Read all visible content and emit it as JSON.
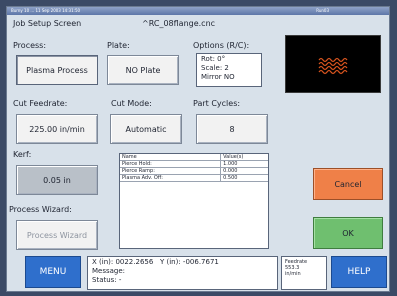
{
  "window": {
    "title_left": "Burny 10 ... 11 Sep 2003 14:31:50",
    "title_right": "Run03"
  },
  "screen": {
    "title": "Job Setup Screen",
    "filename": "^RC_08flange.cnc"
  },
  "process": {
    "label": "Process:",
    "value": "Plasma Process"
  },
  "plate": {
    "label": "Plate:",
    "value": "NO Plate"
  },
  "options": {
    "label": "Options (R/C):",
    "rot": "Rot: 0°",
    "scale": "Scale: 2",
    "mirror": "Mirror NO"
  },
  "cut_feedrate": {
    "label": "Cut Feedrate:",
    "value": "225.00 in/min"
  },
  "cut_mode": {
    "label": "Cut Mode:",
    "value": "Automatic"
  },
  "part_cycles": {
    "label": "Part Cycles:",
    "value": "8"
  },
  "kerf": {
    "label": "Kerf:",
    "value": "0.05 in"
  },
  "params_table": {
    "headers": [
      "Name",
      "Value(s)"
    ],
    "rows": [
      {
        "name": "Pierce Hold:",
        "value": "1.000"
      },
      {
        "name": "Pierce Ramp:",
        "value": "0.000"
      },
      {
        "name": "Plasma Adv. Off:",
        "value": "0.500"
      }
    ]
  },
  "process_wizard": {
    "label": "Process Wizard:",
    "button": "Process Wizard"
  },
  "buttons": {
    "cancel": "Cancel",
    "ok": "OK",
    "menu": "MENU",
    "help": "HELP"
  },
  "status_bar": {
    "x": "X (in): 0022.2656",
    "y": "Y (in): -006.7671",
    "message": "Message:",
    "status": "Status:  -"
  },
  "feedrate_box": {
    "label": "Feedrate",
    "value": "553.3",
    "unit": "in/min"
  },
  "colors": {
    "accent_blue": "#2f6fcc",
    "cancel_orange": "#ef8048",
    "ok_green": "#6fbf6f",
    "preview_pattern": "#d8541e"
  }
}
